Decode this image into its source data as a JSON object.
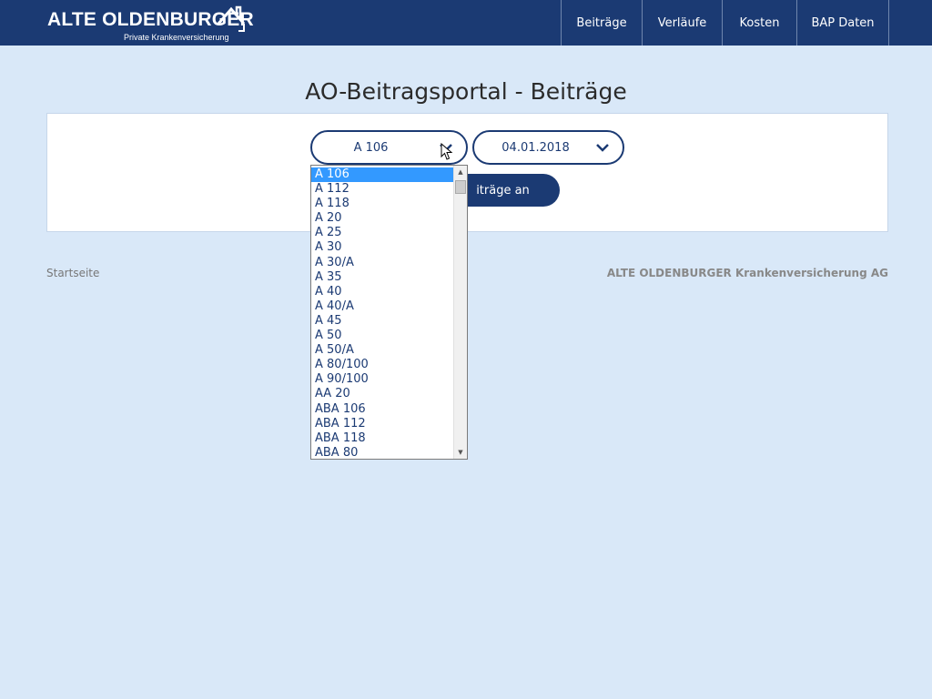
{
  "header": {
    "logo_main": "ALTE OLDENBURGER",
    "logo_sub": "Private Krankenversicherung",
    "nav": [
      "Beiträge",
      "Verläufe",
      "Kosten",
      "BAP Daten"
    ]
  },
  "page": {
    "title": "AO-Beitragsportal - Beiträge"
  },
  "form": {
    "tarif_value": "A 106",
    "date_value": "04.01.2018",
    "submit_label_visible": "iträge an"
  },
  "dropdown": {
    "selected": "A 106",
    "options": [
      "A 106",
      "A 112",
      "A 118",
      "A 20",
      "A 25",
      "A 30",
      "A 30/A",
      "A 35",
      "A 40",
      "A 40/A",
      "A 45",
      "A 50",
      "A 50/A",
      "A 80/100",
      "A 90/100",
      "AA 20",
      "ABA 106",
      "ABA 112",
      "ABA 118",
      "ABA 80"
    ]
  },
  "footer": {
    "home_link": "Startseite",
    "company": "ALTE OLDENBURGER Krankenversicherung AG"
  },
  "colors": {
    "brand": "#1b3a73",
    "background": "#d9e8f8",
    "selection": "#3399ff"
  }
}
